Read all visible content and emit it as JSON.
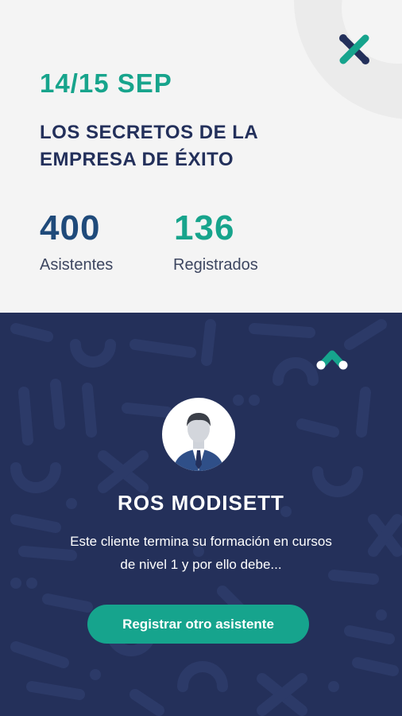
{
  "event": {
    "date": "14/15 SEP",
    "title": "LOS SECRETOS DE LA EMPRESA DE ÉXITO"
  },
  "stats": [
    {
      "value": "400",
      "label": "Asistentes",
      "color": "#1f4a7a"
    },
    {
      "value": "136",
      "label": "Registrados",
      "color": "#17a48c"
    }
  ],
  "attendee": {
    "name": "ROS MODISETT",
    "description": "Este cliente termina su formación en cursos de nivel 1 y por ello debe..."
  },
  "actions": {
    "register_label": "Registrar otro asistente"
  },
  "icons": {
    "logo": "x-logo-icon",
    "collapse": "chevron-up-icon",
    "avatar": "person-avatar-icon"
  },
  "colors": {
    "accent": "#17a48c",
    "navy": "#24305a",
    "top_background": "#f4f4f4"
  }
}
